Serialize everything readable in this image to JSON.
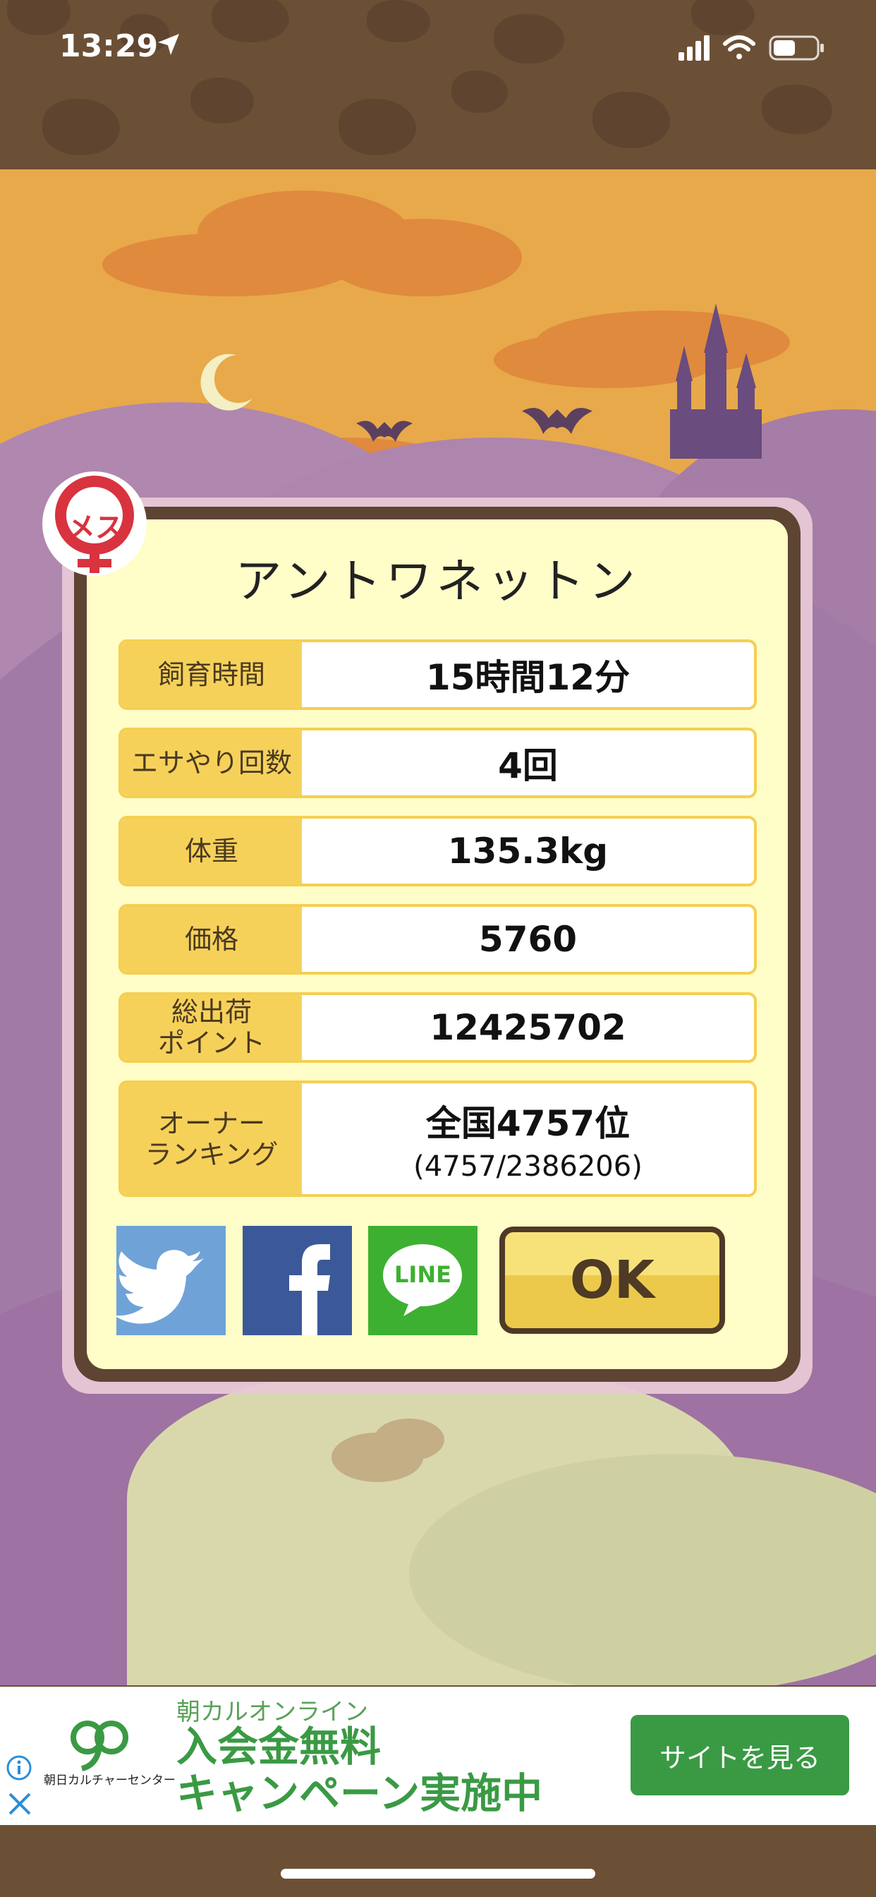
{
  "status_bar": {
    "time": "13:29"
  },
  "dialog": {
    "gender_badge": "メス",
    "name": "アントワネットン",
    "rows": [
      {
        "label": "飼育時間",
        "value": "15時間12分"
      },
      {
        "label": "エサやり回数",
        "value": "4回"
      },
      {
        "label": "体重",
        "value": "135.3kg"
      },
      {
        "label": "価格",
        "value": "5760"
      },
      {
        "label": "総出荷\nポイント",
        "value": "12425702"
      },
      {
        "label": "オーナー\nランキング",
        "value": "全国4757位",
        "sub": "(4757/2386206)"
      }
    ],
    "share": {
      "line_label": "LINE"
    },
    "ok_label": "OK"
  },
  "ad": {
    "brand": "朝日カルチャーセンター",
    "subtitle": "朝カルオンライン",
    "headline_1": "入会金無料",
    "headline_2": "キャンペーン実施中",
    "cta": "サイトを見る"
  },
  "colors": {
    "brown": "#5e4432",
    "yellow": "#f6d15a",
    "cream": "#fffdc8",
    "ad_green": "#3a9a44"
  }
}
